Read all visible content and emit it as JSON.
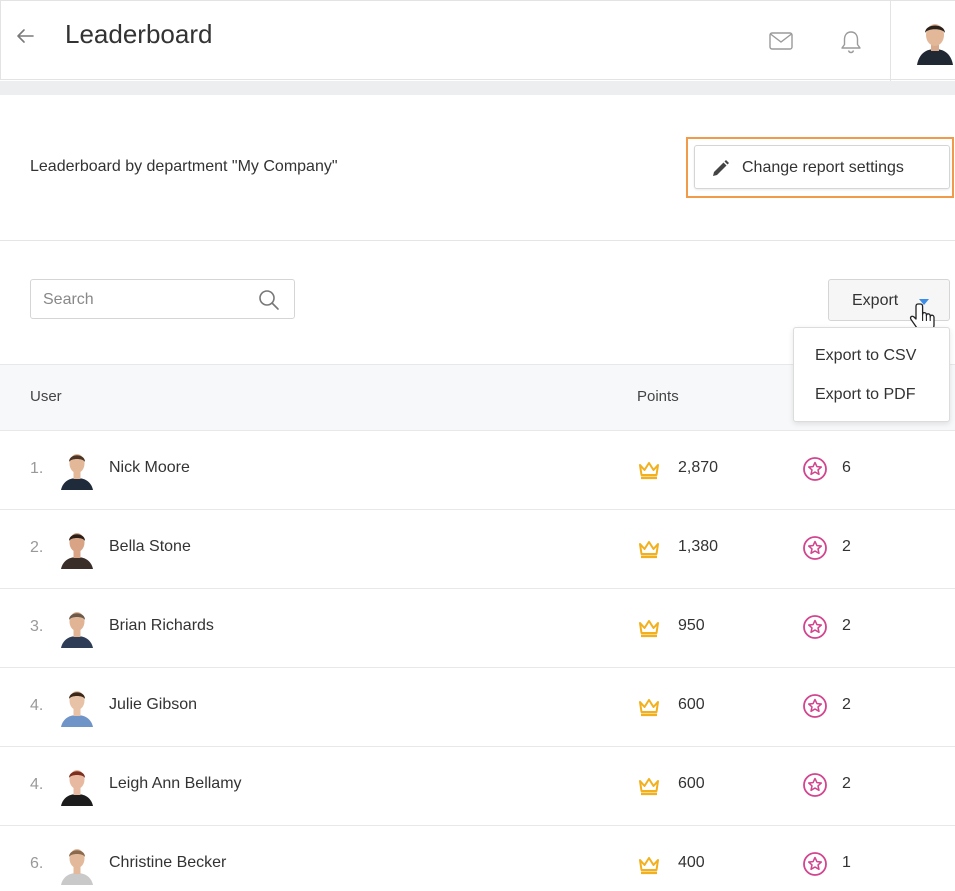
{
  "header": {
    "title": "Leaderboard",
    "back_icon": "arrow-left-icon",
    "mail_icon": "envelope-icon",
    "bell_icon": "bell-icon"
  },
  "subtitle": "Leaderboard by department \"My Company\"",
  "settings_button": {
    "label": "Change report settings",
    "icon": "pencil-icon"
  },
  "search": {
    "placeholder": "Search",
    "value": ""
  },
  "export": {
    "label": "Export",
    "menu": [
      "Export to CSV",
      "Export to PDF"
    ]
  },
  "table": {
    "columns": {
      "user": "User",
      "points": "Points"
    },
    "rows": [
      {
        "rank": "1.",
        "name": "Nick Moore",
        "points": "2,870",
        "badges": "6",
        "avatar": {
          "hair": "#4a3526",
          "skin": "#e3b898",
          "shirt": "#1f2b3a"
        }
      },
      {
        "rank": "2.",
        "name": "Bella Stone",
        "points": "1,380",
        "badges": "2",
        "avatar": {
          "hair": "#2a1e17",
          "skin": "#d9a486",
          "shirt": "#3a2e29"
        }
      },
      {
        "rank": "3.",
        "name": "Brian Richards",
        "points": "950",
        "badges": "2",
        "avatar": {
          "hair": "#6b5a4c",
          "skin": "#e1b495",
          "shirt": "#2e3d55"
        }
      },
      {
        "rank": "4.",
        "name": "Julie Gibson",
        "points": "600",
        "badges": "2",
        "avatar": {
          "hair": "#3a2718",
          "skin": "#e8c2a6",
          "shirt": "#6f95c8"
        }
      },
      {
        "rank": "4.",
        "name": "Leigh Ann Bellamy",
        "points": "600",
        "badges": "2",
        "avatar": {
          "hair": "#7a2f1f",
          "skin": "#e7b9a1",
          "shirt": "#1c1c1c"
        }
      },
      {
        "rank": "6.",
        "name": "Christine Becker",
        "points": "400",
        "badges": "1",
        "avatar": {
          "hair": "#8a6a4c",
          "skin": "#e3b99c",
          "shirt": "#c9c9c9"
        }
      }
    ]
  },
  "colors": {
    "crown": "#f2b01e",
    "badge": "#d2448e",
    "caret": "#3b8ee8",
    "highlight": "#f09a4a"
  }
}
